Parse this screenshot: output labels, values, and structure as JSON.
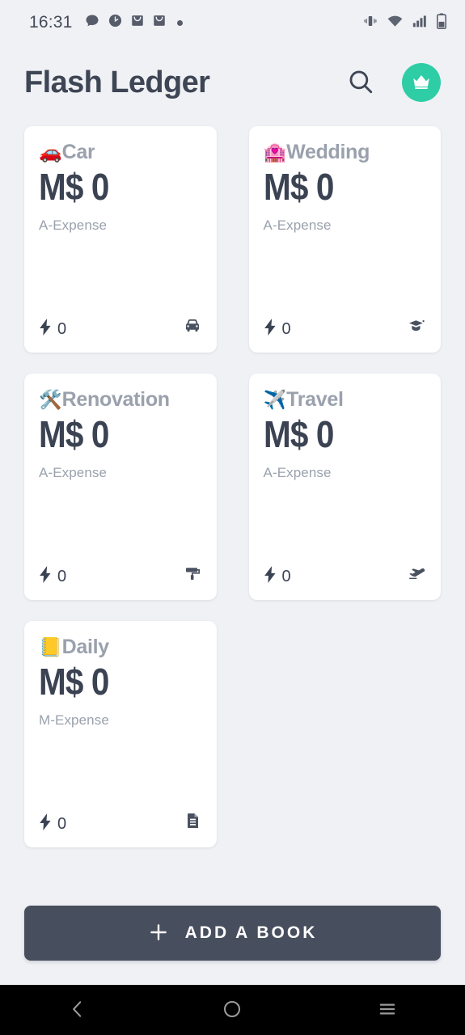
{
  "status_bar": {
    "time": "16:31",
    "left_icons": [
      "chat-bubble-icon",
      "clock-icon",
      "mail-icon",
      "mail-icon",
      "dot-icon"
    ],
    "right_icons": [
      "vibrate-icon",
      "wifi-icon",
      "signal-icon",
      "battery-icon"
    ]
  },
  "header": {
    "title": "Flash Ledger",
    "search_icon": "search-icon",
    "premium_icon": "crown-icon",
    "accent_color": "#2ecda6"
  },
  "books": [
    {
      "emoji": "🚗",
      "emoji_name": "car-emoji",
      "title": "Car",
      "amount": "M$ 0",
      "type": "A-Expense",
      "count": "0",
      "corner_icon": "car-icon"
    },
    {
      "emoji": "🏩",
      "emoji_name": "love-hotel-emoji",
      "title": "Wedding",
      "amount": "M$ 0",
      "type": "A-Expense",
      "count": "0",
      "corner_icon": "graduation-cap-icon"
    },
    {
      "emoji": "🛠️",
      "emoji_name": "hammer-and-wrench-emoji",
      "title": "Renovation",
      "amount": "M$ 0",
      "type": "A-Expense",
      "count": "0",
      "corner_icon": "paint-roller-icon"
    },
    {
      "emoji": "✈️",
      "emoji_name": "airplane-emoji",
      "title": "Travel",
      "amount": "M$ 0",
      "type": "A-Expense",
      "count": "0",
      "corner_icon": "airplane-icon"
    },
    {
      "emoji": "📒",
      "emoji_name": "ledger-notebook-emoji",
      "title": "Daily",
      "amount": "M$ 0",
      "type": "M-Expense",
      "count": "0",
      "corner_icon": "document-icon"
    }
  ],
  "add_button": {
    "label": "ADD A BOOK",
    "icon": "plus-icon",
    "background_color": "#474e5d"
  },
  "nav_bar": {
    "back_icon": "back-chevron-icon",
    "home_icon": "home-circle-icon",
    "recents_icon": "recent-apps-icon"
  },
  "theme": {
    "page_background": "#eff1f5",
    "card_background": "#ffffff",
    "text_dark": "#3b4353",
    "text_muted": "#9aa1ad"
  }
}
